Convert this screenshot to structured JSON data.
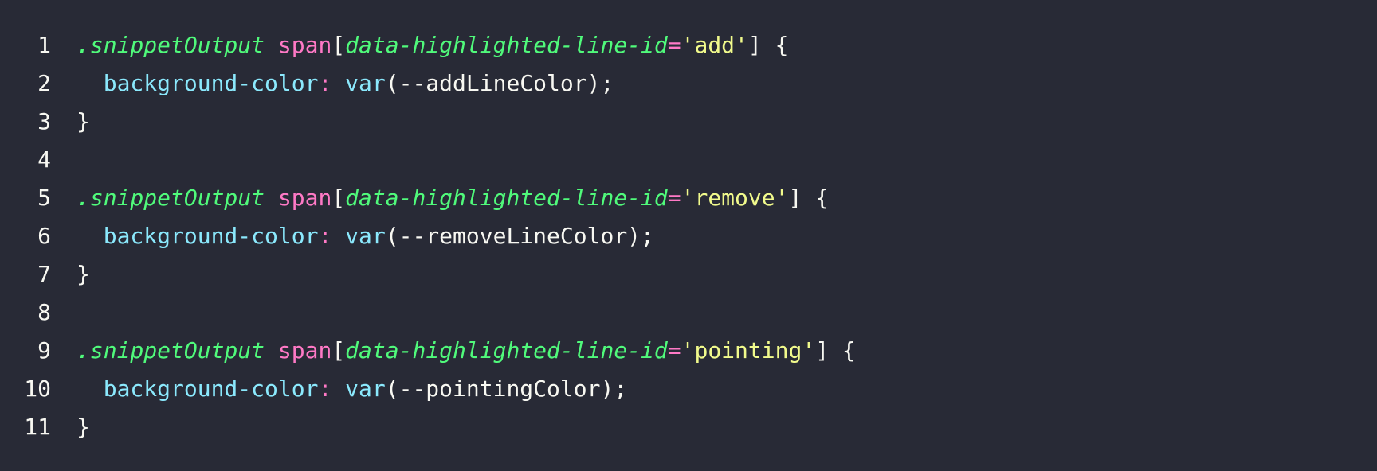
{
  "colors": {
    "background": "#282a36",
    "foreground": "#f8f8f2",
    "green": "#50fa7b",
    "pink": "#ff79c6",
    "yellow": "#f1fa8c",
    "cyan": "#8be9fd"
  },
  "lines": [
    {
      "number": "1",
      "tokens": [
        {
          "type": "class",
          "text": ".snippetOutput"
        },
        {
          "type": "punct",
          "text": " "
        },
        {
          "type": "tag",
          "text": "span"
        },
        {
          "type": "punct",
          "text": "["
        },
        {
          "type": "attr",
          "text": "data-highlighted-line-id"
        },
        {
          "type": "op",
          "text": "="
        },
        {
          "type": "string",
          "text": "'add'"
        },
        {
          "type": "punct",
          "text": "] {"
        }
      ]
    },
    {
      "number": "2",
      "tokens": [
        {
          "type": "punct",
          "text": "  "
        },
        {
          "type": "prop",
          "text": "background-color"
        },
        {
          "type": "op",
          "text": ":"
        },
        {
          "type": "punct",
          "text": " "
        },
        {
          "type": "func",
          "text": "var"
        },
        {
          "type": "punct",
          "text": "("
        },
        {
          "type": "ident",
          "text": "--addLineColor"
        },
        {
          "type": "punct",
          "text": ");"
        }
      ]
    },
    {
      "number": "3",
      "tokens": [
        {
          "type": "punct",
          "text": "}"
        }
      ]
    },
    {
      "number": "4",
      "tokens": []
    },
    {
      "number": "5",
      "tokens": [
        {
          "type": "class",
          "text": ".snippetOutput"
        },
        {
          "type": "punct",
          "text": " "
        },
        {
          "type": "tag",
          "text": "span"
        },
        {
          "type": "punct",
          "text": "["
        },
        {
          "type": "attr",
          "text": "data-highlighted-line-id"
        },
        {
          "type": "op",
          "text": "="
        },
        {
          "type": "string",
          "text": "'remove'"
        },
        {
          "type": "punct",
          "text": "] {"
        }
      ]
    },
    {
      "number": "6",
      "tokens": [
        {
          "type": "punct",
          "text": "  "
        },
        {
          "type": "prop",
          "text": "background-color"
        },
        {
          "type": "op",
          "text": ":"
        },
        {
          "type": "punct",
          "text": " "
        },
        {
          "type": "func",
          "text": "var"
        },
        {
          "type": "punct",
          "text": "("
        },
        {
          "type": "ident",
          "text": "--removeLineColor"
        },
        {
          "type": "punct",
          "text": ");"
        }
      ]
    },
    {
      "number": "7",
      "tokens": [
        {
          "type": "punct",
          "text": "}"
        }
      ]
    },
    {
      "number": "8",
      "tokens": []
    },
    {
      "number": "9",
      "tokens": [
        {
          "type": "class",
          "text": ".snippetOutput"
        },
        {
          "type": "punct",
          "text": " "
        },
        {
          "type": "tag",
          "text": "span"
        },
        {
          "type": "punct",
          "text": "["
        },
        {
          "type": "attr",
          "text": "data-highlighted-line-id"
        },
        {
          "type": "op",
          "text": "="
        },
        {
          "type": "string",
          "text": "'pointing'"
        },
        {
          "type": "punct",
          "text": "] {"
        }
      ]
    },
    {
      "number": "10",
      "tokens": [
        {
          "type": "punct",
          "text": "  "
        },
        {
          "type": "prop",
          "text": "background-color"
        },
        {
          "type": "op",
          "text": ":"
        },
        {
          "type": "punct",
          "text": " "
        },
        {
          "type": "func",
          "text": "var"
        },
        {
          "type": "punct",
          "text": "("
        },
        {
          "type": "ident",
          "text": "--pointingColor"
        },
        {
          "type": "punct",
          "text": ");"
        }
      ]
    },
    {
      "number": "11",
      "tokens": [
        {
          "type": "punct",
          "text": "}"
        }
      ]
    }
  ]
}
